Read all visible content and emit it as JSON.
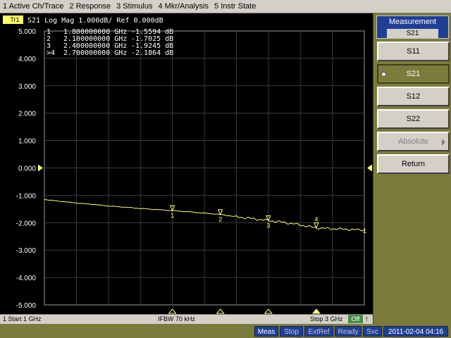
{
  "menu": [
    "1 Active Ch/Trace",
    "2 Response",
    "3 Stimulus",
    "4 Mkr/Analysis",
    "5 Instr State"
  ],
  "trace": {
    "id": "Tr1",
    "header": "S21 Log Mag 1.000dB/ Ref 0.000dB",
    "ref_label": "0.000",
    "color": "#ffff6b"
  },
  "markers": [
    {
      "label": "1",
      "prefix": " ",
      "freq_ghz": 1.8,
      "freq_text": "1.800000000 GHz",
      "value_db": -1.5594,
      "value_text": "-1.5594 dB"
    },
    {
      "label": "2",
      "prefix": " ",
      "freq_ghz": 2.1,
      "freq_text": "2.100000000 GHz",
      "value_db": -1.7025,
      "value_text": "-1.7025 dB"
    },
    {
      "label": "3",
      "prefix": " ",
      "freq_ghz": 2.4,
      "freq_text": "2.400000000 GHz",
      "value_db": -1.9245,
      "value_text": "-1.9245 dB"
    },
    {
      "label": "4",
      "prefix": ">",
      "freq_ghz": 2.7,
      "freq_text": "2.700000000 GHz",
      "value_db": -2.1864,
      "value_text": "-2.1864 dB"
    }
  ],
  "chart_data": {
    "type": "line",
    "y_tick_labels": [
      "5.000",
      "4.000",
      "3.000",
      "2.000",
      "1.000",
      "0.000",
      "-1.000",
      "-2.000",
      "-3.000",
      "-4.000",
      "-5.000"
    ],
    "ylim": [
      -5,
      5
    ],
    "xlim_ghz": [
      1,
      3
    ],
    "grid": true,
    "series": [
      {
        "name": "S21",
        "x": [
          1.0,
          1.1,
          1.2,
          1.3,
          1.4,
          1.5,
          1.6,
          1.7,
          1.8,
          1.9,
          2.0,
          2.1,
          2.2,
          2.3,
          2.4,
          2.5,
          2.6,
          2.7,
          2.8,
          2.9,
          3.0
        ],
        "values": [
          -1.15,
          -1.22,
          -1.28,
          -1.33,
          -1.39,
          -1.43,
          -1.48,
          -1.52,
          -1.56,
          -1.6,
          -1.65,
          -1.7,
          -1.78,
          -1.85,
          -1.92,
          -1.99,
          -2.08,
          -2.19,
          -2.22,
          -2.24,
          -2.27
        ]
      }
    ]
  },
  "channel": {
    "start": "1  Start 1 GHz",
    "ifbw": "IFBW 70 kHz",
    "stop": "Stop 3 GHz",
    "off": "Off",
    "bang": "!"
  },
  "softkeys": {
    "title": "Measurement",
    "current": "S21",
    "items": [
      {
        "label": "S11",
        "state": "normal"
      },
      {
        "label": "S21",
        "state": "active"
      },
      {
        "label": "S12",
        "state": "normal"
      },
      {
        "label": "S22",
        "state": "normal"
      },
      {
        "label": "Absolute",
        "state": "disabled"
      },
      {
        "label": "Return",
        "state": "normal"
      }
    ]
  },
  "status": {
    "meas": "Meas",
    "stop": "Stop",
    "extref": "ExtRef",
    "ready": "Ready",
    "svc": "Svc",
    "datetime": "2011-02-04 04:16"
  }
}
